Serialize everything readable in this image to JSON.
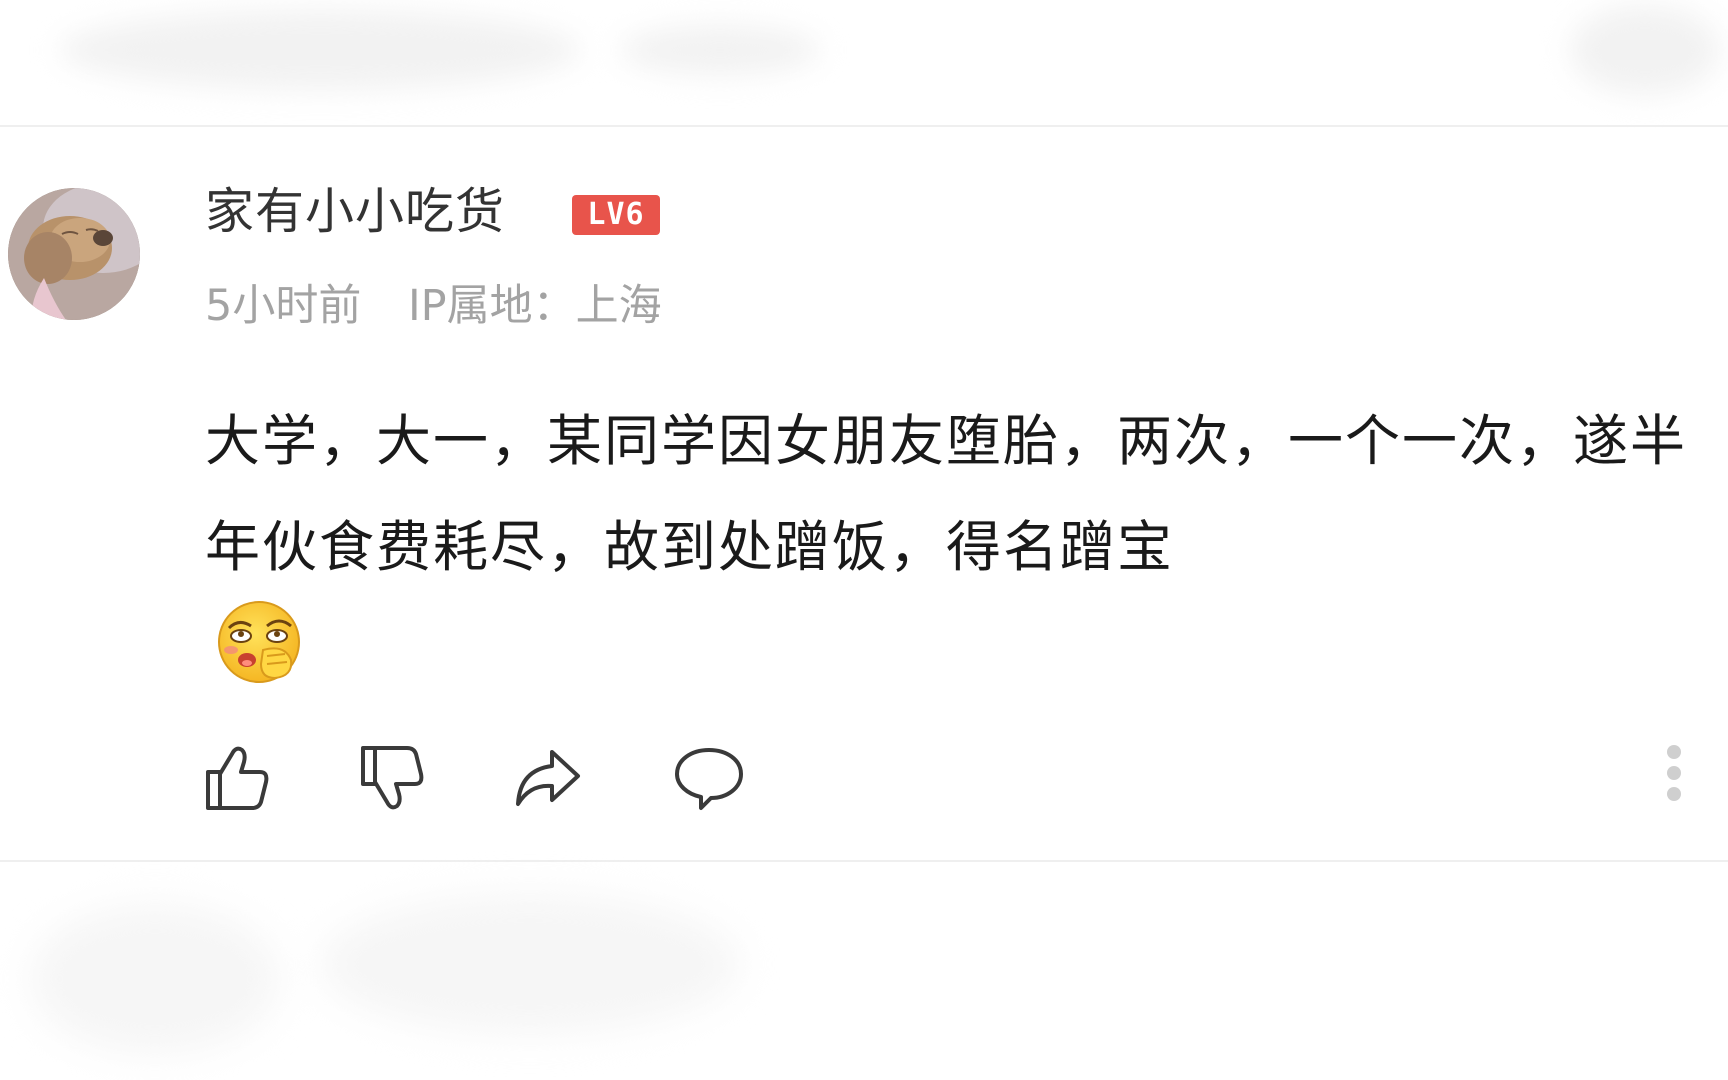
{
  "comment": {
    "user": {
      "name": "家有小小吃货",
      "level_badge": "LV6"
    },
    "time": "5小时前",
    "ip_location": "IP属地：上海",
    "text": "大学，大一，某同学因女朋友堕胎，两次，一个一次，遂半年伙食费耗尽，故到处蹭饭，得名蹭宝",
    "emoji_icon": "covering-mouth-laugh-emoji"
  },
  "actions": {
    "like_icon": "thumbs-up-icon",
    "dislike_icon": "thumbs-down-icon",
    "share_icon": "share-arrow-icon",
    "reply_icon": "comment-bubble-icon",
    "more_icon": "more-vertical-icon"
  },
  "colors": {
    "badge": "#e8544b",
    "meta_text": "#a3a3a3",
    "icon_stroke": "#3a3a3a"
  }
}
